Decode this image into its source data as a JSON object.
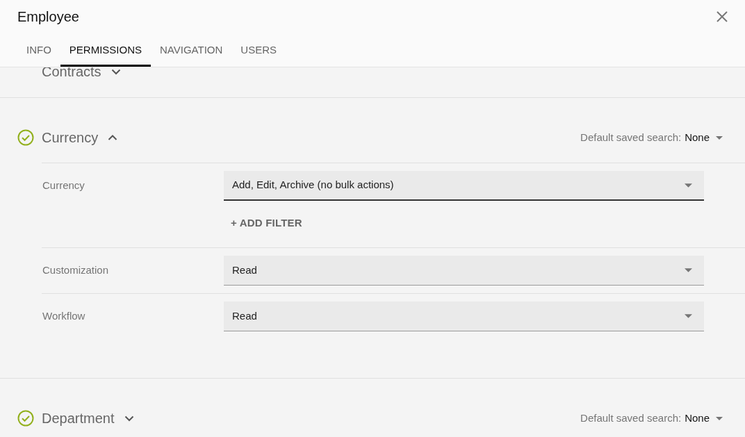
{
  "window": {
    "title": "Employee"
  },
  "tabs": [
    {
      "label": "INFO",
      "selected": false
    },
    {
      "label": "PERMISSIONS",
      "selected": true
    },
    {
      "label": "NAVIGATION",
      "selected": false
    },
    {
      "label": "USERS",
      "selected": false
    }
  ],
  "sections": [
    {
      "title": "Contracts",
      "checked": false,
      "expanded": false
    },
    {
      "title": "Currency",
      "checked": true,
      "expanded": true,
      "saved_search": {
        "label": "Default saved search:",
        "value": "None"
      },
      "permissions": [
        {
          "label": "Currency",
          "value": "Add, Edit, Archive (no bulk actions)",
          "focused": true,
          "filter_button": "+ ADD FILTER"
        },
        {
          "label": "Customization",
          "value": "Read",
          "focused": false
        },
        {
          "label": "Workflow",
          "value": "Read",
          "focused": false
        }
      ]
    },
    {
      "title": "Department",
      "checked": true,
      "expanded": false,
      "saved_search": {
        "label": "Default saved search:",
        "value": "None"
      }
    }
  ]
}
